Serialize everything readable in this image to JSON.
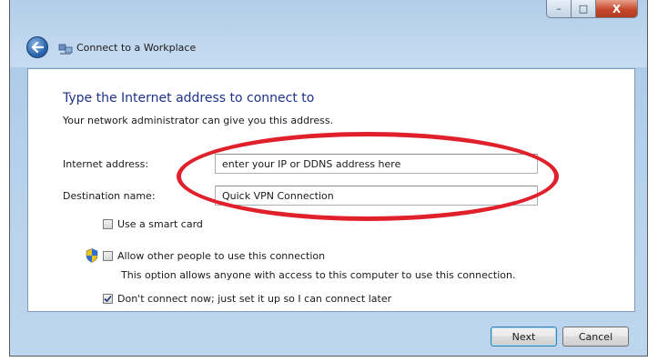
{
  "window": {
    "title": "Connect to a Workplace",
    "caption_minimize": "–",
    "caption_maximize": "□",
    "caption_close": "X"
  },
  "content": {
    "heading": "Type the Internet address to connect to",
    "subtext": "Your network administrator can give you this address.",
    "internet_address": {
      "label": "Internet address:",
      "value": "enter your IP or DDNS address here"
    },
    "destination_name": {
      "label": "Destination name:",
      "value": "Quick VPN Connection"
    },
    "options": [
      {
        "label": "Use a smart card",
        "checked": false
      },
      {
        "label": "Allow other people to use this connection",
        "checked": false,
        "shield": true
      },
      {
        "label": "Don't connect now; just set it up so I can connect later",
        "checked": true
      }
    ],
    "allow_explanation": "This option allows anyone with access to this computer to use this connection."
  },
  "buttons": {
    "next": "Next",
    "cancel": "Cancel"
  },
  "colors": {
    "heading": "#1e3287",
    "annotation": "#e0202a",
    "frame": "#b9d3ec"
  }
}
